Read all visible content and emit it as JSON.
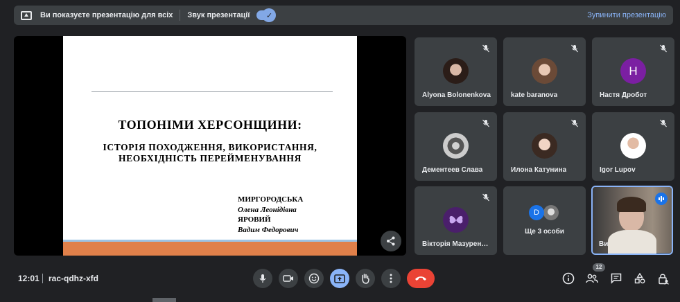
{
  "top_bar": {
    "presenting_text": "Ви показуєте презентацію для всіх",
    "sound_label": "Звук презентації",
    "stop_label": "Зупинити презентацію"
  },
  "slide": {
    "title": "ТОПОНІМИ ХЕРСОНЩИНИ:",
    "subtitle_line1": "ІСТОРІЯ ПОХОДЖЕННЯ, ВИКОРИСТАННЯ,",
    "subtitle_line2": "НЕОБХІДНІСТЬ ПЕРЕЙМЕНУВАННЯ",
    "author1_surname": "МИРГОРОДСЬКА",
    "author1_name": "Олена Леонідівна",
    "author2_surname": "ЯРОВИЙ",
    "author2_name": "Вадим Федорович"
  },
  "participants": [
    {
      "name": "Alyona Bolonenkova",
      "avatar": "photo-girl-dark-hair-icon",
      "muted": true
    },
    {
      "name": "kate baranova",
      "avatar": "photo-girl-light-hair-icon",
      "muted": true
    },
    {
      "name": "Настя Дробот",
      "avatar_letter": "H",
      "avatar_color": "#7b1fa2",
      "muted": true
    },
    {
      "name": "Дементеев Слава",
      "avatar": "photo-bw-icon",
      "muted": true
    },
    {
      "name": "Илона Катунина",
      "avatar": "photo-girl-icon",
      "muted": true
    },
    {
      "name": "Igor Lupov",
      "avatar": "photo-man-icon",
      "muted": true
    },
    {
      "name": "Вікторія Мазурен…",
      "avatar": "butterfly-icon",
      "muted": true
    }
  ],
  "more_tile": {
    "label": "Ще 3 особи",
    "avatar_letter": "D",
    "avatar_color": "#1a73e8"
  },
  "self_tile": {
    "name": "Ви"
  },
  "bottom_bar": {
    "time": "12:01",
    "meeting_code": "rac-qdhz-xfd",
    "participant_count": "12"
  },
  "colors": {
    "background": "#202124",
    "tile": "#3c4043",
    "accent": "#8ab4f8",
    "leave": "#ea4335",
    "slide_band": "#e0804a"
  }
}
